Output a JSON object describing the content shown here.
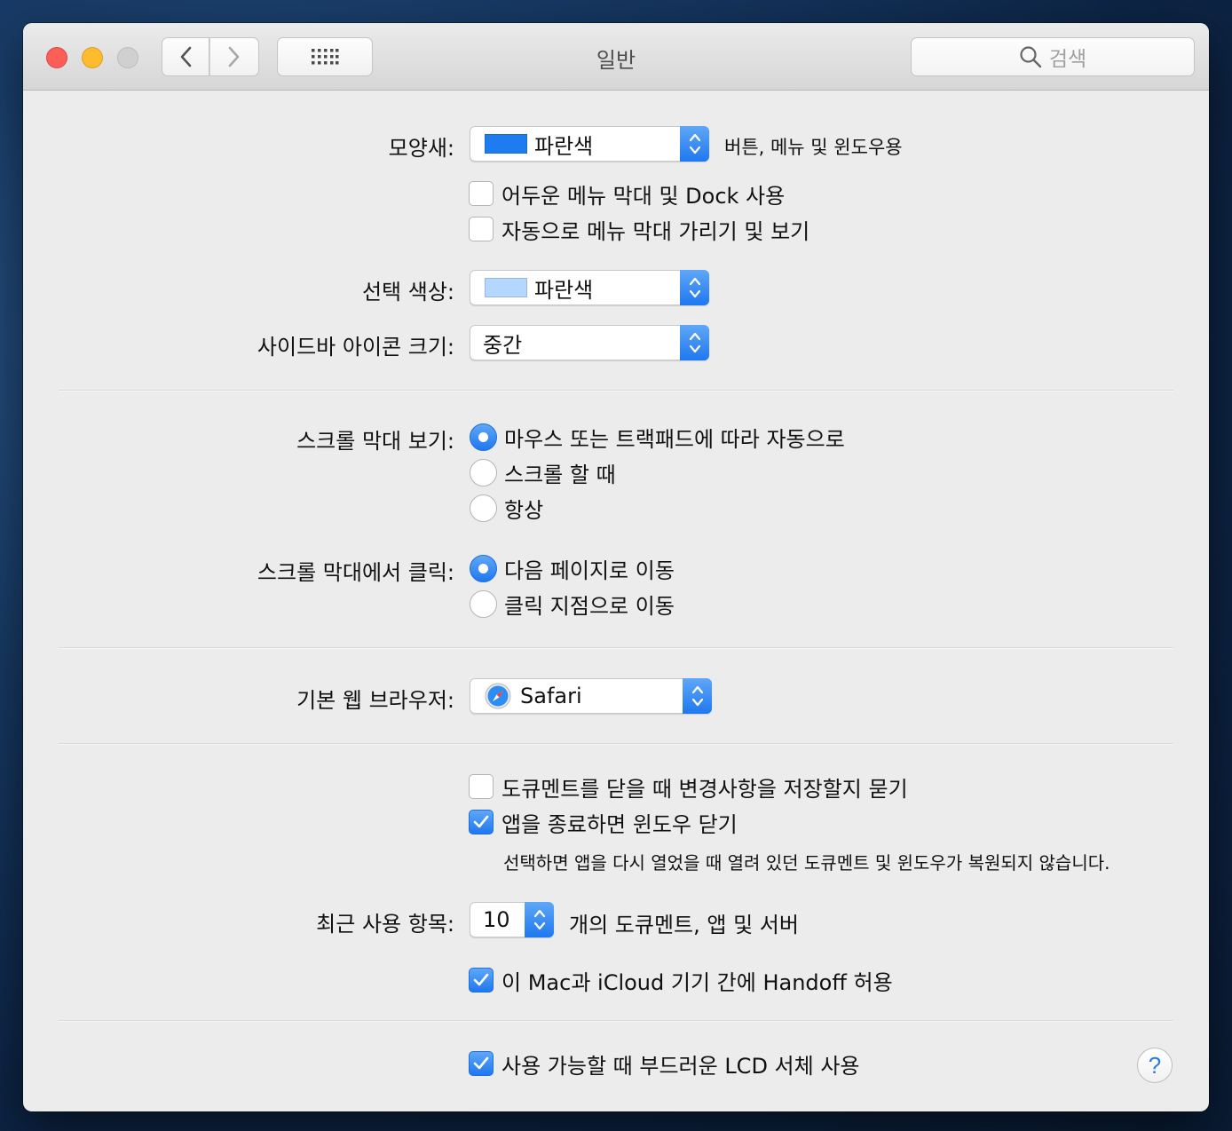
{
  "window": {
    "title": "일반",
    "search_placeholder": "검색"
  },
  "appearance": {
    "label": "모양새:",
    "value": "파란색",
    "swatch_color": "#1f7cf0",
    "note": "버튼, 메뉴 및 윈도우용",
    "dark_menu_label": "어두운 메뉴 막대 및 Dock 사용",
    "dark_menu_checked": false,
    "autohide_menu_label": "자동으로 메뉴 막대 가리기 및 보기",
    "autohide_menu_checked": false
  },
  "highlight": {
    "label": "선택 색상:",
    "value": "파란색",
    "swatch_color": "#b3d7ff"
  },
  "sidebar_icon": {
    "label": "사이드바 아이콘 크기:",
    "value": "중간"
  },
  "show_scrollbars": {
    "label": "스크롤 막대 보기:",
    "options": [
      "마우스 또는 트랙패드에 따라 자동으로",
      "스크롤 할 때",
      "항상"
    ],
    "selected": 0
  },
  "click_scrollbar": {
    "label": "스크롤 막대에서 클릭:",
    "options": [
      "다음 페이지로 이동",
      "클릭 지점으로 이동"
    ],
    "selected": 0
  },
  "browser": {
    "label": "기본 웹 브라우저:",
    "value": "Safari",
    "icon": "safari-compass-icon"
  },
  "documents": {
    "ask_keep_label": "도큐멘트를 닫을 때 변경사항을 저장할지 묻기",
    "ask_keep_checked": false,
    "close_windows_label": "앱을 종료하면 윈도우 닫기",
    "close_windows_checked": true,
    "hint": "선택하면 앱을 다시 열었을 때 열려 있던 도큐멘트 및 윈도우가 복원되지 않습니다."
  },
  "recent_items": {
    "label": "최근 사용 항목:",
    "value": "10",
    "suffix": "개의 도큐멘트, 앱 및 서버"
  },
  "handoff": {
    "label": "이 Mac과 iCloud 기기 간에 Handoff 허용",
    "checked": true
  },
  "lcd_font": {
    "label": "사용 가능할 때 부드러운 LCD 서체 사용",
    "checked": true
  },
  "help_label": "?"
}
